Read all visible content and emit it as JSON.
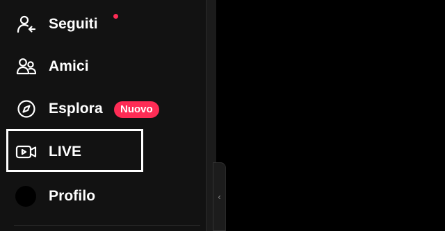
{
  "sidebar": {
    "items": [
      {
        "id": "seguiti",
        "label": "Seguiti",
        "icon": "user-follow-icon",
        "notification_dot": true
      },
      {
        "id": "amici",
        "label": "Amici",
        "icon": "users-icon"
      },
      {
        "id": "esplora",
        "label": "Esplora",
        "icon": "compass-icon",
        "badge": "Nuovo"
      },
      {
        "id": "live",
        "label": "LIVE",
        "icon": "video-camera-icon",
        "highlighted": true
      },
      {
        "id": "profilo",
        "label": "Profilo",
        "icon": "avatar"
      }
    ],
    "collapse_handle": {
      "glyph": "‹"
    }
  },
  "colors": {
    "background": "#000000",
    "sidebar": "#121212",
    "accent": "#fe2c55",
    "text": "#ffffff",
    "highlight_box": "#ffffff"
  }
}
